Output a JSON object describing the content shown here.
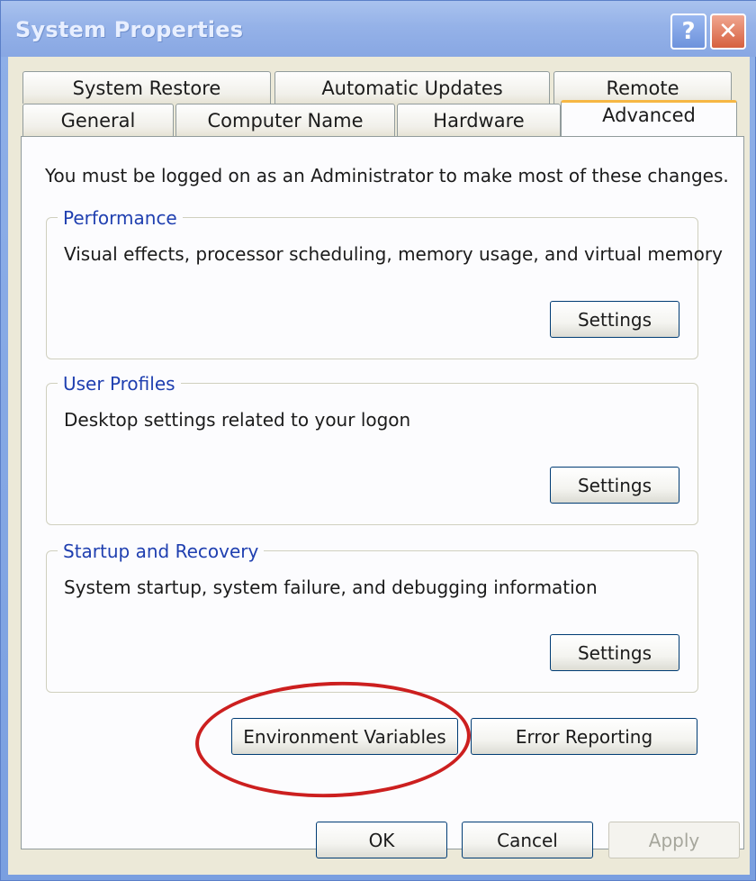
{
  "window": {
    "title": "System Properties"
  },
  "titlebar": {
    "help_glyph": "?",
    "close_glyph": "✕"
  },
  "tabs": {
    "row1": [
      {
        "label": "System Restore"
      },
      {
        "label": "Automatic Updates"
      },
      {
        "label": "Remote"
      }
    ],
    "row2": [
      {
        "label": "General"
      },
      {
        "label": "Computer Name"
      },
      {
        "label": "Hardware"
      },
      {
        "label": "Advanced",
        "active": true
      }
    ]
  },
  "advanced": {
    "admin_note": "You must be logged on as an Administrator to make most of these changes.",
    "groups": [
      {
        "title": "Performance",
        "description": "Visual effects, processor scheduling, memory usage, and virtual memory",
        "button": "Settings"
      },
      {
        "title": "User Profiles",
        "description": "Desktop settings related to your logon",
        "button": "Settings"
      },
      {
        "title": "Startup and Recovery",
        "description": "System startup, system failure, and debugging information",
        "button": "Settings"
      }
    ],
    "env_vars_button": "Environment Variables",
    "error_reporting_button": "Error Reporting"
  },
  "footer": {
    "ok": "OK",
    "cancel": "Cancel",
    "apply": "Apply",
    "apply_enabled": false
  },
  "colors": {
    "annotation_circle": "#cc1f1f",
    "active_tab_accent": "#f6b744",
    "group_title": "#1f3fb0"
  },
  "icons": {
    "help": "help-icon",
    "close": "close-icon"
  }
}
